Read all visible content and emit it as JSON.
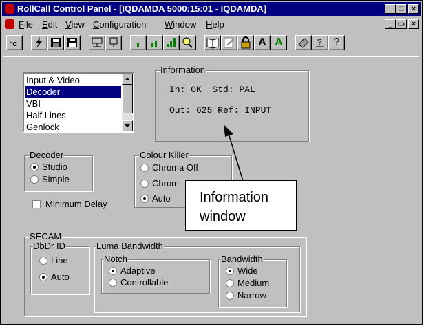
{
  "window": {
    "title": "RollCall Control Panel - [IQDAMDA 5000:15:01 - IQDAMDA]",
    "caption_buttons": [
      "_",
      "□",
      "×"
    ],
    "mdi_buttons": [
      "_",
      "▭",
      "×"
    ]
  },
  "menu": {
    "items": [
      {
        "label": "File",
        "u": "F",
        "rest": "ile"
      },
      {
        "label": "Edit",
        "u": "E",
        "rest": "dit"
      },
      {
        "label": "View",
        "u": "V",
        "rest": "iew"
      },
      {
        "label": "Configuration",
        "u": "C",
        "rest": "onfiguration"
      },
      {
        "label": "Window",
        "u": "W",
        "rest": "indow"
      },
      {
        "label": "Help",
        "u": "H",
        "rest": "elp"
      }
    ]
  },
  "toolbar": {
    "font_large": "A",
    "font_green": "A",
    "help_q": "?"
  },
  "listbox": {
    "items": [
      "Input & Video",
      "Decoder",
      "VBI",
      "Half Lines",
      "Genlock"
    ],
    "selected": "Decoder"
  },
  "information": {
    "legend": "Information",
    "line1": "In: OK  Std: PAL",
    "line2": "Out: 625 Ref: INPUT"
  },
  "decoder": {
    "legend": "Decoder",
    "options": [
      "Studio",
      "Simple"
    ],
    "selected": "Studio"
  },
  "colour_killer": {
    "legend": "Colour Killer",
    "options": [
      "Chroma Off",
      "Chrom",
      "Auto"
    ],
    "selected": "Auto"
  },
  "minimum_delay": {
    "label": "Minimum Delay",
    "checked": false
  },
  "secam": {
    "legend": "SECAM",
    "dbdr": {
      "legend": "DbDr ID",
      "options": [
        "Line",
        "Auto"
      ],
      "selected": "Auto"
    },
    "luma": {
      "legend": "Luma Bandwidth",
      "notch": {
        "legend": "Notch",
        "options": [
          "Adaptive",
          "Controllable"
        ],
        "selected": "Adaptive"
      },
      "bandwidth": {
        "legend": "Bandwidth",
        "options": [
          "Wide",
          "Medium",
          "Narrow"
        ],
        "selected": "Wide"
      }
    }
  },
  "callout": {
    "line1": "Information",
    "line2": "window"
  }
}
